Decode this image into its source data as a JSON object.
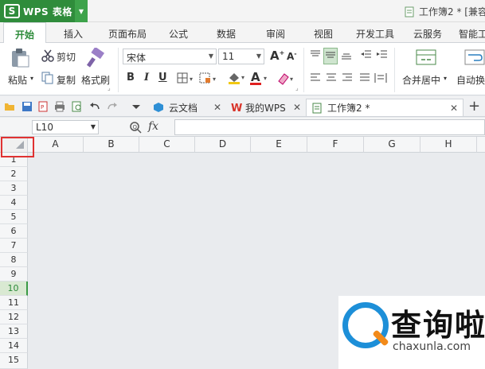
{
  "app": {
    "logo": "S",
    "name": "WPS 表格",
    "document_title": "工作簿2 * [兼容"
  },
  "ribbon_tabs": [
    "开始",
    "插入",
    "页面布局",
    "公式",
    "数据",
    "审阅",
    "视图",
    "开发工具",
    "云服务",
    "智能工"
  ],
  "clipboard": {
    "paste": "粘贴",
    "cut": "剪切",
    "copy": "复制",
    "format_painter": "格式刷"
  },
  "font": {
    "name": "宋体",
    "size": "11",
    "bold": "B",
    "italic": "I",
    "underline": "U",
    "color_letter": "A"
  },
  "alignment": {
    "merge_center": "合并居中",
    "auto_wrap": "自动换"
  },
  "doc_tabs": [
    {
      "label": "云文档"
    },
    {
      "label": "我的WPS"
    },
    {
      "label": "工作簿2 *"
    }
  ],
  "formula_bar": {
    "name_box": "L10",
    "fx": "fx"
  },
  "grid": {
    "columns": [
      "A",
      "B",
      "C",
      "D",
      "E",
      "F",
      "G",
      "H"
    ],
    "rows": [
      "1",
      "2",
      "3",
      "4",
      "5",
      "6",
      "7",
      "8",
      "9",
      "10",
      "11",
      "12",
      "13",
      "14",
      "15"
    ],
    "selected_row": "10"
  },
  "watermark": {
    "text": "查询啦",
    "url": "chaxunla.com"
  },
  "colors": {
    "brand_green": "#2f8c3b",
    "highlight_red": "#e03232",
    "watermark_blue": "#1d8fd8",
    "watermark_orange": "#f28a1a"
  }
}
